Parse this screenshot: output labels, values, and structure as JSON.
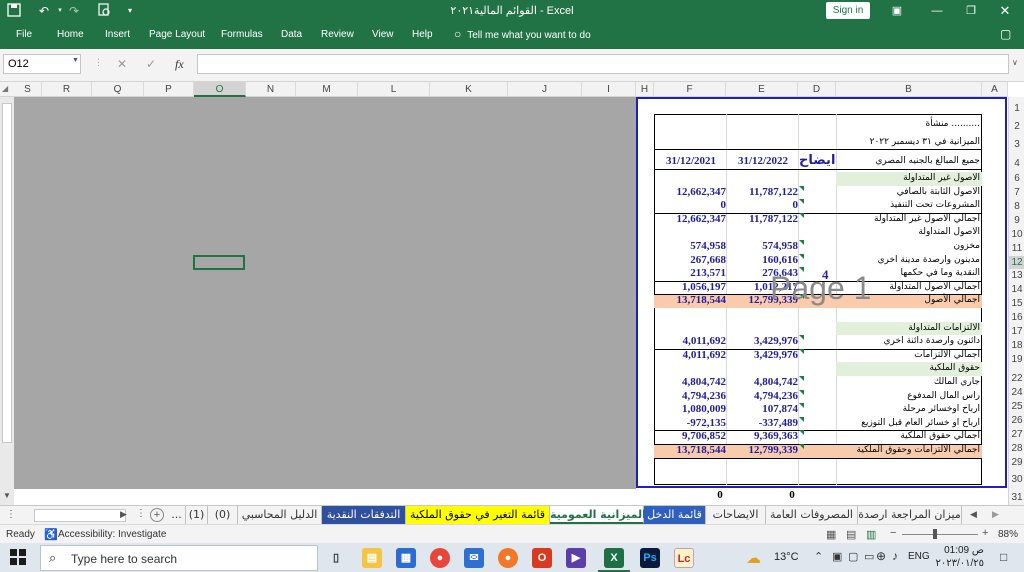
{
  "titlebar": {
    "title": "القوائم المالية٢٠٢١  -  Excel",
    "signin_label": "Sign in"
  },
  "ribbon": {
    "tabs": [
      "File",
      "Home",
      "Insert",
      "Page Layout",
      "Formulas",
      "Data",
      "Review",
      "View",
      "Help"
    ],
    "tell_me": "Tell me what you want to do"
  },
  "formula_bar": {
    "name_box": "O12",
    "fx": "fx",
    "formula": ""
  },
  "columns": [
    "S",
    "R",
    "Q",
    "P",
    "O",
    "N",
    "M",
    "L",
    "K",
    "J",
    "I",
    "H",
    "F",
    "E",
    "D",
    "B",
    "A"
  ],
  "rows": [
    "1",
    "2",
    "3",
    "4",
    "6",
    "7",
    "8",
    "9",
    "10",
    "11",
    "12",
    "13",
    "14",
    "15",
    "16",
    "17",
    "18",
    "19",
    "22",
    "24",
    "25",
    "26",
    "27",
    "28",
    "29",
    "30",
    "31"
  ],
  "sheet": {
    "company": "منشأة ..........",
    "balance_title": "الميزانية  في   ٣١ ديسمبر ٢٠٢٢",
    "currency_note": "جميع المبالغ بالجنيه المصري",
    "col_note": "ايضاح",
    "col_2022": "31/12/2022",
    "col_2021": "31/12/2021",
    "note_4": "4",
    "watermark": "Page 1",
    "lines": [
      {
        "label": "الاصول غير المتداولة",
        "v22": "",
        "v21": "",
        "style": "green"
      },
      {
        "label": "الاصول الثابتة بالصافي",
        "v22": "11,787,122",
        "v21": "12,662,347",
        "style": ""
      },
      {
        "label": "المشروعات تحت التنفيذ",
        "v22": "0",
        "v21": "0",
        "style": ""
      },
      {
        "label": "اجمالي الاصول غير المتداولة",
        "v22": "11,787,122",
        "v21": "12,662,347",
        "style": "total"
      },
      {
        "label": "الاصول المتداولة",
        "v22": "",
        "v21": "",
        "style": ""
      },
      {
        "label": "مخزون",
        "v22": "574,958",
        "v21": "574,958",
        "style": ""
      },
      {
        "label": "مدينون وارصدة مدينة اخري",
        "v22": "160,616",
        "v21": "267,668",
        "style": ""
      },
      {
        "label": "النقدية وما في حكمها",
        "v22": "276,643",
        "v21": "213,571",
        "style": ""
      },
      {
        "label": "اجمالي الاصول المتداولة",
        "v22": "1,012,217",
        "v21": "1,056,197",
        "style": "total"
      },
      {
        "label": "اجمالي الأصول",
        "v22": "12,799,339",
        "v21": "13,718,544",
        "style": "orange"
      },
      {
        "label": "",
        "v22": "",
        "v21": "",
        "style": ""
      },
      {
        "label": "الالتزامات المتداولة",
        "v22": "",
        "v21": "",
        "style": "green"
      },
      {
        "label": "دائنون وارصدة دائنة اخري",
        "v22": "3,429,976",
        "v21": "4,011,692",
        "style": ""
      },
      {
        "label": "اجمالي الالتزامات",
        "v22": "3,429,976",
        "v21": "4,011,692",
        "style": "total"
      },
      {
        "label": "حقوق الملكية",
        "v22": "",
        "v21": "",
        "style": "green"
      },
      {
        "label": "جاري المالك",
        "v22": "4,804,742",
        "v21": "4,804,742",
        "style": ""
      },
      {
        "label": "راس المال المدفوع",
        "v22": "4,794,236",
        "v21": "4,794,236",
        "style": ""
      },
      {
        "label": "ارباح اوخسائر مرحلة",
        "v22": "107,874",
        "v21": "1,080,009",
        "style": ""
      },
      {
        "label": "ارباح او خسائر العام قبل التوزيع",
        "v22": "-337,489",
        "v21": "-972,135",
        "style": ""
      },
      {
        "label": "اجمالي حقوق الملكية",
        "v22": "9,369,363",
        "v21": "9,706,852",
        "style": "total"
      },
      {
        "label": "اجمالي الالتزامات وحقوق الملكية",
        "v22": "12,799,339",
        "v21": "13,718,544",
        "style": "orange"
      }
    ],
    "zero_e": "0",
    "zero_f": "0"
  },
  "sheet_tabs": [
    "ميزان المراجعة ارصدة",
    "المصروفات العامة",
    "الايضاحات",
    "قائمة الدخل",
    "الميزانية العمومية",
    "قائمة التغير في حقوق الملكية",
    "التدفقات النقدية",
    "الدليل المحاسبي",
    "(0)",
    "(1)",
    "..."
  ],
  "status": {
    "ready": "Ready",
    "accessibility": "Accessibility: Investigate",
    "zoom": "88%"
  },
  "taskbar": {
    "search_placeholder": "Type here to search",
    "temperature": "13°C",
    "lang": "ENG",
    "time": "01:09 ص",
    "date": "٢٠٢٣/٠١/٢٥"
  },
  "colors": {
    "excel_green": "#217346",
    "print_border": "#1f1fbf",
    "total_fill": "#f8cbad",
    "section_fill": "#e2efda"
  }
}
